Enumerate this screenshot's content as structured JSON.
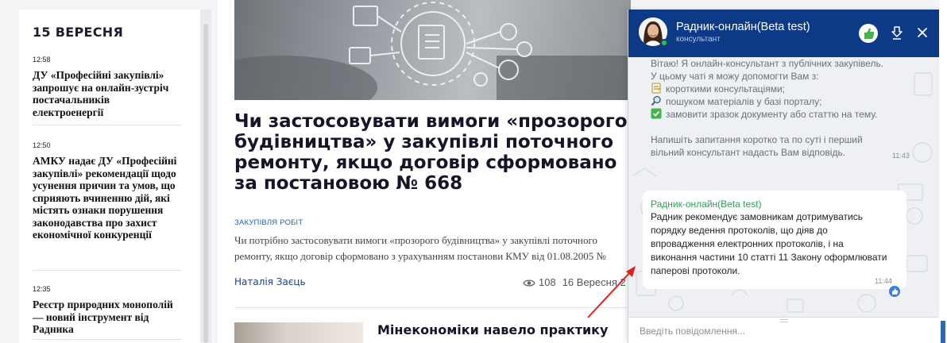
{
  "sidebar": {
    "date_heading": "15 ВЕРЕСНЯ",
    "items": [
      {
        "time": "12:58",
        "title": "ДУ «Професійні закупівлі» запрошує на онлайн-зустріч постачальників електроенергії"
      },
      {
        "time": "12:50",
        "title": "АМКУ надає ДУ «Професійні закупівлі» рекомендації щодо усунення причин та умов, що сприяють вчиненню дій, які містять ознаки порушення законодавства про захист економічної конкуренції"
      },
      {
        "time": "12:35",
        "title": "Реєстр природних монополій — новий інструмент від Радника"
      }
    ]
  },
  "article": {
    "headline": "Чи застосовувати вимоги «прозорого будівництва» у закупівлі поточного ремонту, якщо договір сформовано за постановою № 668",
    "rubric": "ЗАКУПІВЛЯ РОБІТ",
    "lead": "Чи потрібно застосовувати вимоги «прозорого будівництва» у закупівлі поточного ремонту, якщо договір сформовано з урахуванням постанови КМУ від 01.08.2005 №",
    "author": "Наталія Заєць",
    "views": "108",
    "date": "16 Вересня 2"
  },
  "next_article": {
    "headline": "Мінекономіки навело практику"
  },
  "chat": {
    "title": "Радник-онлайн(Beta test)",
    "subtitle": "консультант",
    "welcome_lines": [
      "Вітаю! Я онлайн-консультант з публічних закупівель.",
      "У цьому чаті я можу допомогти Вам з:",
      "короткими консультаціями;",
      "пошуком матеріалів у базі порталу;",
      "замовити зразок документу або статтю на тему.",
      "Напишіть запитання коротко та по суті і перший",
      "вільний консультант надасть Вам відповідь."
    ],
    "welcome_time": "11:43",
    "reply_name": "Радник-онлайн(Beta test)",
    "reply_text": "Радник рекомендує замовникам дотримуватись порядку ведення протоколів, що діяв до впровадження електронних протоколів, і на виконання частини 10 статті 11 Закону оформлювати паперові протоколи.",
    "reply_time": "11:44",
    "input_placeholder": "Введіть повідомлення..."
  },
  "icons": {
    "emoji_1": "memo-icon",
    "emoji_2": "magnifier-icon",
    "emoji_3": "check-box-icon"
  },
  "colors": {
    "chat_header": "#0c3a87",
    "accent_green": "#2e9e53",
    "link_blue": "#2a5ea8",
    "arrow_red": "#e0201c"
  }
}
